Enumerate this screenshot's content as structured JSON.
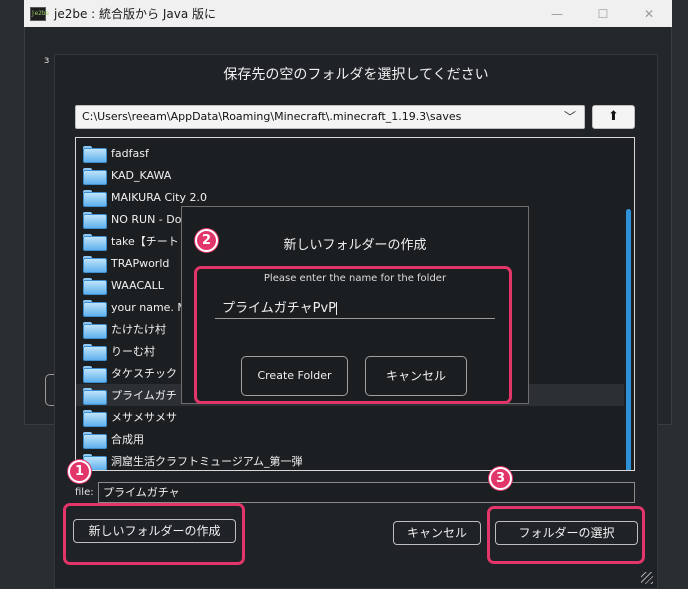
{
  "window": {
    "title": "je2be : 統合版から Java 版に",
    "icon_text": "je2be",
    "minimize": "—",
    "maximize": "☐",
    "close": "✕"
  },
  "background": {
    "fragment": "з"
  },
  "dialog": {
    "title": "保存先の空のフォルダを選択してください",
    "path": "C:\\Users\\reeam\\AppData\\Roaming\\Minecraft\\.minecraft_1.19.3\\saves",
    "path_caret": "﹀",
    "up_button": "⬆",
    "folders": [
      "fadfasf",
      "KAD_KAWA",
      "MAIKURA City 2.0",
      "NO RUN - Doub",
      "take【チート",
      "TRAPworld",
      "WAACALL",
      "your name. Mi",
      "たけたけ村",
      "りーむ村",
      "タケスチック",
      "プライムガチ",
      "メサメサメサ",
      "合成用",
      "洞窟生活クラフトミュージアム_第一弾"
    ],
    "selected_index": 11,
    "file_label": "file:",
    "file_value": "プライムガチャ",
    "new_folder_button": "新しいフォルダーの作成",
    "cancel_button": "キャンセル",
    "select_button": "フォルダーの選択"
  },
  "modal": {
    "title": "新しいフォルダーの作成",
    "prompt": "Please enter the name for the folder",
    "input_value": "プライムガチャPvP",
    "create_button": "Create Folder",
    "cancel_button": "キャンセル"
  },
  "annotations": {
    "badge1": "1",
    "badge2": "2",
    "badge3": "3"
  },
  "colors": {
    "highlight": "#e2356a",
    "folder_blue": "#5fb0ec",
    "scroll_thumb": "#2f92d9"
  }
}
